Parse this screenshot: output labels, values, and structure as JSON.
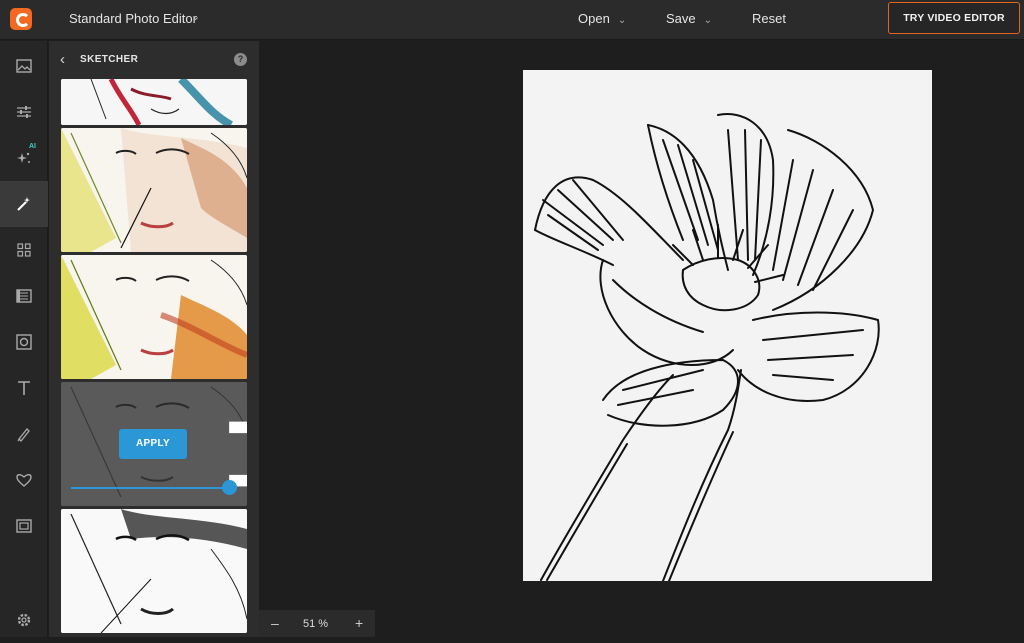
{
  "header": {
    "app_title": "Standard Photo Editor",
    "menu": [
      {
        "label": "Open"
      },
      {
        "label": "Save"
      },
      {
        "label": "Reset"
      }
    ],
    "try_button": "TRY VIDEO EDITOR",
    "accent_color": "#e4641e"
  },
  "rail": {
    "items": [
      {
        "icon": "image-icon"
      },
      {
        "icon": "adjust-sliders-icon"
      },
      {
        "icon": "ai-sparkle-icon",
        "badge": "AI"
      },
      {
        "icon": "magic-wand-icon",
        "active": true
      },
      {
        "icon": "grid-icon"
      },
      {
        "icon": "texture-icon"
      },
      {
        "icon": "frame-icon"
      },
      {
        "icon": "text-icon"
      },
      {
        "icon": "brush-icon"
      },
      {
        "icon": "heart-icon"
      },
      {
        "icon": "border-icon"
      },
      {
        "icon": "settings-icon"
      }
    ]
  },
  "panel": {
    "title": "SKETCHER",
    "help": "?",
    "apply_label": "APPLY",
    "slider_value": 1.0,
    "slider_color": "#2b97d6"
  },
  "bottom": {
    "zoom_minus": "–",
    "zoom_value": "51 %",
    "zoom_plus": "+"
  }
}
